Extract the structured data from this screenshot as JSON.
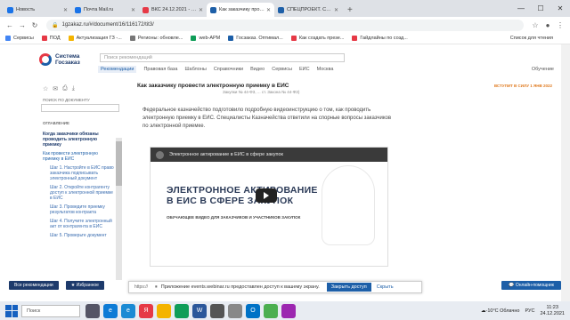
{
  "browser": {
    "tabs": [
      {
        "label": "Новость",
        "color": "#1a73e8"
      },
      {
        "label": "Почта Mail.ru",
        "color": "#1a73e8"
      },
      {
        "label": "ВКС 24.12.2021 - тест",
        "color": "#e63946"
      },
      {
        "label": "Как заказчику провести",
        "color": "#1d5fa8",
        "active": true
      },
      {
        "label": "СПЕЦПРОЕКТ. Сборник",
        "color": "#1d5fa8"
      }
    ],
    "url": "1gzakaz.ru/#/document/16/116172/tit3/",
    "bookmarks": [
      "Сервисы",
      "ПОД",
      "Актуализация ГЗ -...",
      "Регионы: обновле...",
      "web-АРМ",
      "Госзаказ. Оптимал...",
      "Как создать презе...",
      "Гайдлайны по созд..."
    ],
    "reading_list": "Список для чтения"
  },
  "site": {
    "logo_line1": "Система",
    "logo_line2": "Госзаказ",
    "search_placeholder": "Поиск рекомендаций",
    "menu": [
      "Рекомендации",
      "Правовая база",
      "Шаблоны",
      "Справочники",
      "Видео",
      "Сервисы",
      "ЕИС",
      "Москва"
    ],
    "learn": "Обучение"
  },
  "sidebar": {
    "search_label": "ПОИСК ПО ДОКУМЕНТУ",
    "toc_header": "ОГЛАВЛЕНИЕ",
    "toc": [
      {
        "text": "Когда заказчики обязаны проводить электронную приемку",
        "type": "active"
      },
      {
        "text": "Как провести электронную приемку в ЕИС",
        "type": "item"
      },
      {
        "text": "Шаг 1. Настройте в ЕИС право заказчика подписывать электронный документ",
        "type": "sub"
      },
      {
        "text": "Шаг 2. Откройте контрагенту доступ к электронной приемке в ЕИС",
        "type": "sub"
      },
      {
        "text": "Шаг 3. Проведите приемку результатов контракта",
        "type": "sub"
      },
      {
        "text": "Шаг 4. Получите электронный акт от контрагента в ЕИС",
        "type": "sub"
      },
      {
        "text": "Шаг 5. Проверьте документ",
        "type": "sub"
      }
    ],
    "btn_all": "Все рекомендации",
    "btn_fav": "Избранное"
  },
  "content": {
    "title": "Как заказчику провести электронную приемку в ЕИС",
    "badge": "ВСТУПИТ В СИЛУ 1 ЯНВ 2022",
    "refs": "Закупки № 44-ФЗ, ... ст. Закона № 44-ФЗ)",
    "paragraph": "Федеральное казначейство подготовило подробную видеоинструкцию о том, как проводить электронную приемку в ЕИС. Специалисты Казначейства ответили на спорные вопросы заказчиков по электронной приемке.",
    "video_top": "Электронное актирование в ЕИС в сфере закупок",
    "video_title_1": "ЭЛЕКТРОННОЕ АКТИРОВАНИЕ",
    "video_title_2": "В ЕИС В СФЕРЕ ЗАКУПОК",
    "video_sub": "ОБУЧАЮЩЕЕ ВИДЕО ДЛЯ ЗАКАЗЧИКОВ И УЧАСТНИКОВ ЗАКУПОК"
  },
  "notification": {
    "prefix": "https://",
    "text": "Приложение events.webinar.ru предоставлен доступ к вашему экрану.",
    "allow": "Закрыть доступ",
    "hide": "Скрыть"
  },
  "helper": "Онлайн-помощник",
  "taskbar": {
    "search": "Поиск",
    "weather": "-10°C Облачно",
    "lang": "РУС",
    "time": "11:23",
    "date": "24.12.2021"
  }
}
